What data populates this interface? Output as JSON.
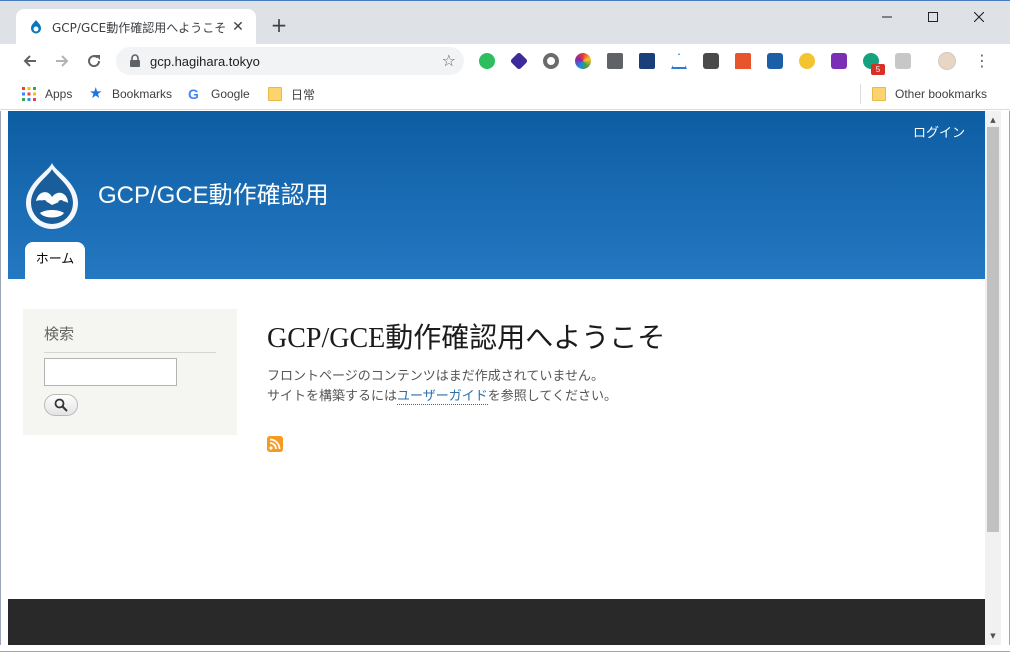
{
  "browser": {
    "tab_title": "GCP/GCE動作確認用へようこそ | GC",
    "url": "gcp.hagihara.tokyo",
    "bookmarks": {
      "apps": "Apps",
      "bookmarks": "Bookmarks",
      "google": "Google",
      "folder": "日常",
      "other": "Other bookmarks"
    },
    "extension_badge": "5",
    "extensions": [
      "evernote-icon",
      "layers-icon",
      "circle-icon",
      "color-ring-icon",
      "inbox-icon",
      "id-icon",
      "triangle-icon",
      "bulb-icon",
      "lighthouse-icon",
      "calendar-icon",
      "hand-icon",
      "onenote-icon",
      "grammarly-icon",
      "puzzle-icon"
    ]
  },
  "site": {
    "login": "ログイン",
    "name": "GCP/GCE動作確認用",
    "tab_home": "ホーム",
    "brand_color": "#1a67ad"
  },
  "sidebar": {
    "heading": "検索",
    "search_value": ""
  },
  "main": {
    "title": "GCP/GCE動作確認用へようこそ",
    "line1": "フロントページのコンテンツはまだ作成されていません。",
    "line2_prefix": "サイトを構築するには",
    "line2_link": "ユーザーガイド",
    "line2_suffix": "を参照してください。"
  }
}
